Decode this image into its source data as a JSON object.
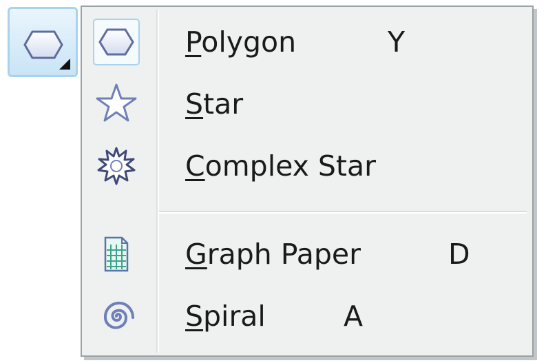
{
  "toolbar": {
    "button_icon": "polygon-icon",
    "flyout_indicator": "flyout-triangle-icon"
  },
  "menu": {
    "items": [
      {
        "pre": "",
        "mnemonic": "P",
        "post": "olygon",
        "shortcut": "Y",
        "icon": "polygon-icon",
        "checked": true
      },
      {
        "pre": "",
        "mnemonic": "S",
        "post": "tar",
        "shortcut": "",
        "icon": "star-icon",
        "checked": false
      },
      {
        "pre": "",
        "mnemonic": "C",
        "post": "omplex Star",
        "shortcut": "",
        "icon": "complex-star-icon",
        "checked": false
      },
      {
        "pre": "",
        "mnemonic": "G",
        "post": "raph Paper",
        "shortcut": "D",
        "icon": "graph-paper-icon",
        "checked": false
      },
      {
        "pre": "",
        "mnemonic": "S",
        "post": "piral",
        "shortcut": "A",
        "icon": "spiral-icon",
        "checked": false
      }
    ]
  },
  "colors": {
    "menu_bg": "#eff1f1",
    "highlight_border": "#a9d2ee",
    "icon_blue": "#6f7fb8",
    "grid_green": "#3aa58a"
  }
}
